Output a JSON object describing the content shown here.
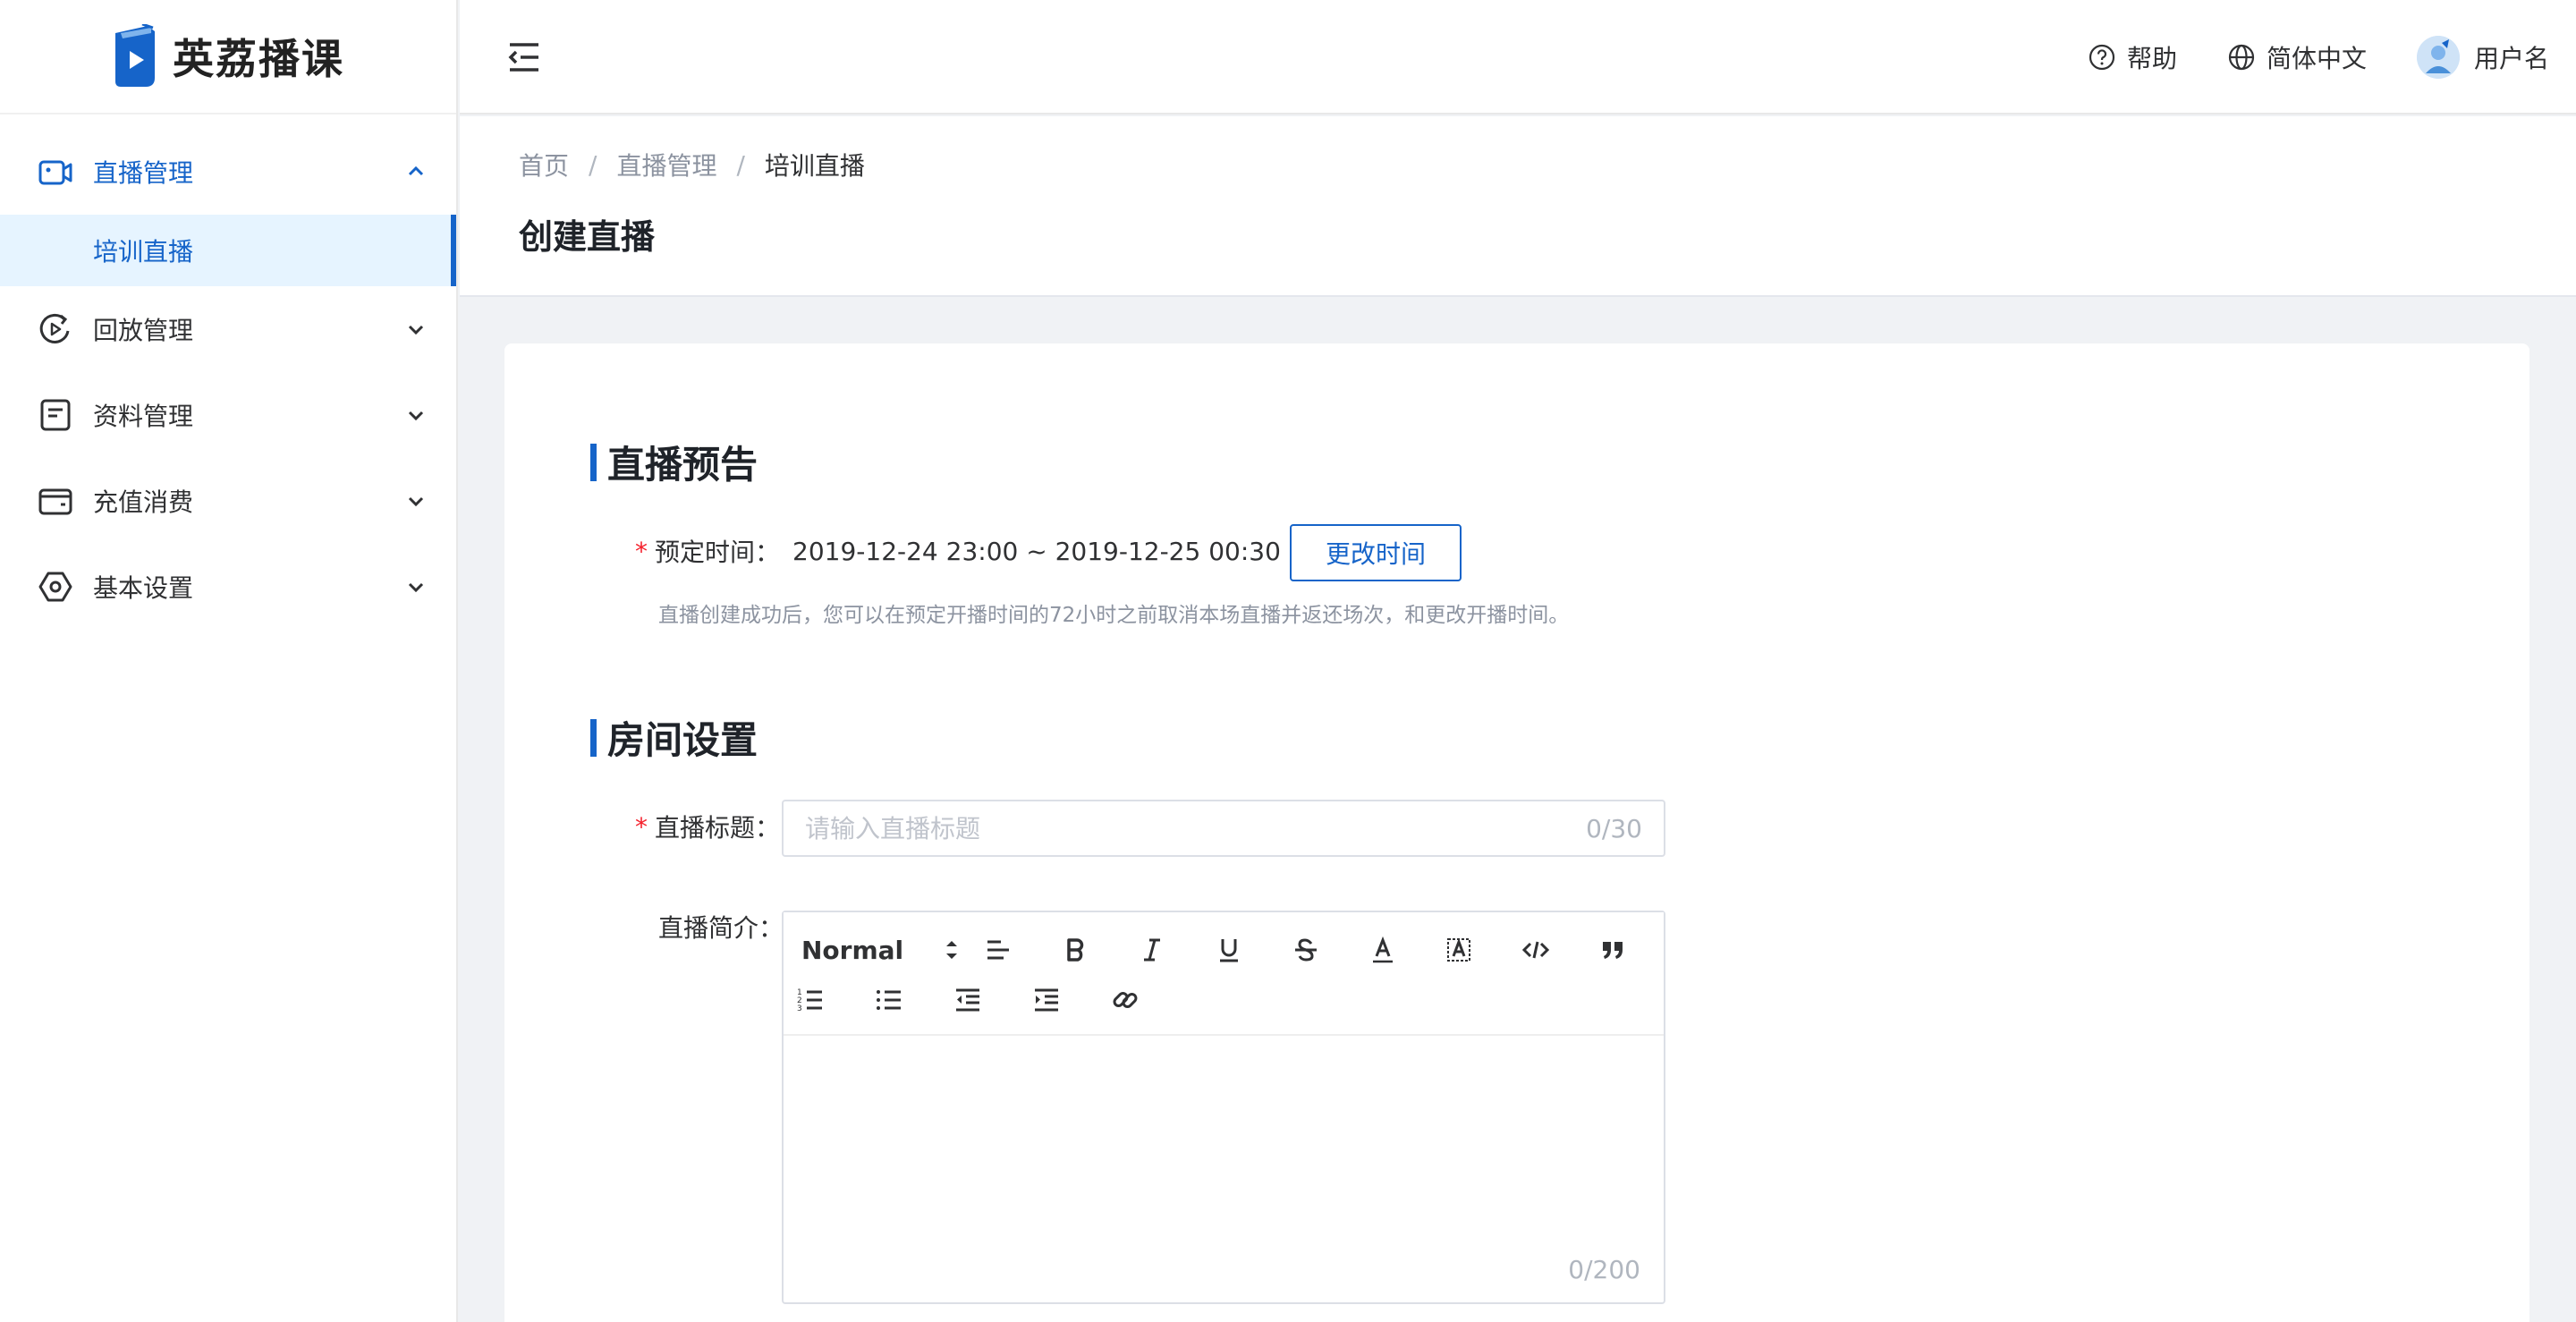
{
  "app": {
    "logo_text": "英荔播课"
  },
  "sidebar": {
    "items": [
      {
        "label": "直播管理",
        "icon": "camera-icon",
        "expanded": true,
        "active": true
      },
      {
        "label": "回放管理",
        "icon": "playback-icon"
      },
      {
        "label": "资料管理",
        "icon": "document-icon"
      },
      {
        "label": "充值消费",
        "icon": "wallet-icon"
      },
      {
        "label": "基本设置",
        "icon": "settings-hexagon-icon"
      }
    ],
    "sub_items": [
      {
        "label": "培训直播",
        "active": true
      }
    ]
  },
  "header": {
    "help_label": "帮助",
    "language_label": "简体中文",
    "username": "用户名"
  },
  "breadcrumb": {
    "home": "首页",
    "parent": "直播管理",
    "current": "培训直播",
    "separator": "/"
  },
  "page": {
    "title": "创建直播"
  },
  "preview_section": {
    "title": "直播预告",
    "time_label": "预定时间：",
    "time_value": "2019-12-24 23:00 ~ 2019-12-25 00:30",
    "change_button": "更改时间",
    "hint": "直播创建成功后，您可以在预定开播时间的72小时之前取消本场直播并返还场次，和更改开播时间。"
  },
  "room_section": {
    "title": "房间设置",
    "title_label": "直播标题：",
    "title_placeholder": "请输入直播标题",
    "title_counter": "0/30",
    "intro_label": "直播简介：",
    "editor": {
      "format_value": "Normal",
      "counter": "0/200"
    }
  },
  "colors": {
    "primary": "#1664c9",
    "required": "#f5222d",
    "active_bg": "#e6f4ff",
    "page_bg": "#f0f2f5"
  }
}
